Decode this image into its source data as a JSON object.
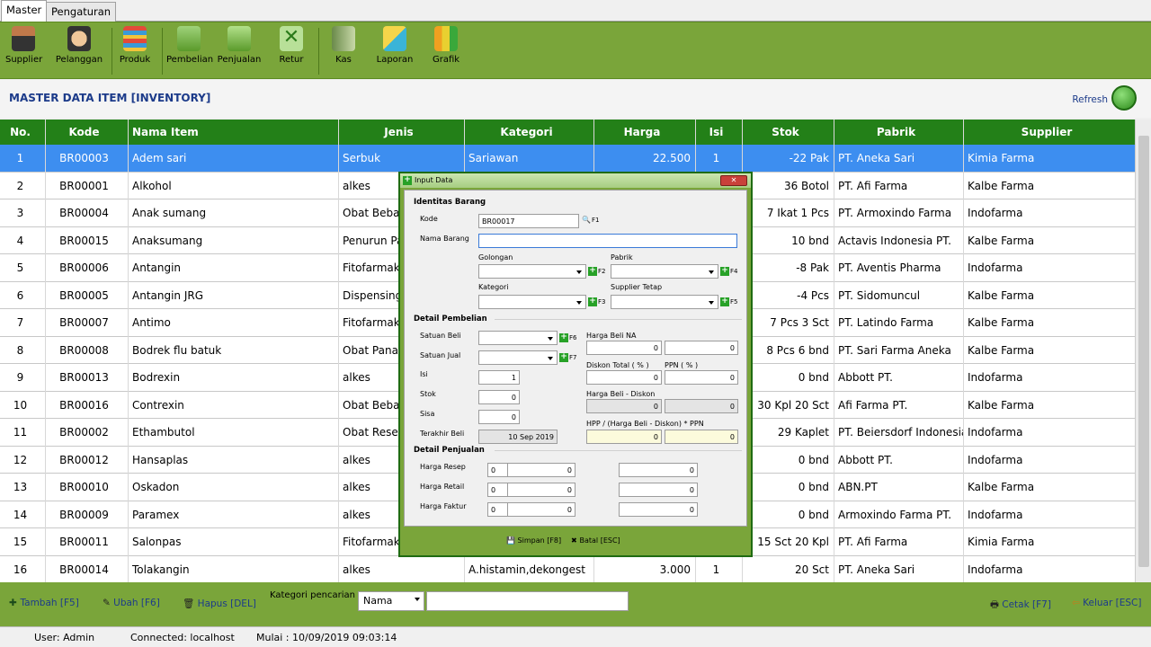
{
  "tabs": [
    "Master",
    "Pengaturan"
  ],
  "toolbar": [
    {
      "label": "Supplier",
      "icon": "supplier-icon"
    },
    {
      "label": "Pelanggan",
      "icon": "pelanggan-icon"
    },
    {
      "label": "Produk",
      "icon": "produk-icon"
    },
    {
      "label": "Pembelian",
      "icon": "pembelian-icon"
    },
    {
      "label": "Penjualan",
      "icon": "penjualan-icon"
    },
    {
      "label": "Retur",
      "icon": "retur-icon"
    },
    {
      "label": "Kas",
      "icon": "kas-icon"
    },
    {
      "label": "Laporan",
      "icon": "laporan-icon"
    },
    {
      "label": "Grafik",
      "icon": "grafik-icon"
    }
  ],
  "page_title": "MASTER DATA ITEM [INVENTORY]",
  "refresh_label": "Refresh",
  "columns": [
    "No.",
    "Kode",
    "Nama Item",
    "Jenis",
    "Kategori",
    "Harga",
    "Isi",
    "Stok",
    "Pabrik",
    "Supplier"
  ],
  "rows": [
    [
      "1",
      "BR00003",
      "Adem sari",
      "Serbuk",
      "Sariawan",
      "22.500",
      "1",
      "-22 Pak",
      "PT. Aneka Sari",
      "Kimia Farma"
    ],
    [
      "2",
      "BR00001",
      "Alkohol",
      "alkes",
      "",
      "",
      "",
      "36 Botol",
      "PT. Afi Farma",
      "Kalbe Farma"
    ],
    [
      "3",
      "BR00004",
      "Anak sumang",
      "Obat Bebas",
      "",
      "",
      "",
      "7 Ikat 1 Pcs",
      "PT. Armoxindo Farma",
      "Indofarma"
    ],
    [
      "4",
      "BR00015",
      "Anaksumang",
      "Penurun Pa",
      "",
      "",
      "",
      "10 bnd",
      "Actavis Indonesia PT.",
      "Kalbe Farma"
    ],
    [
      "5",
      "BR00006",
      "Antangin",
      "Fitofarmaka",
      "",
      "",
      "",
      "-8 Pak",
      "PT. Aventis Pharma",
      "Indofarma"
    ],
    [
      "6",
      "BR00005",
      "Antangin JRG",
      "Dispensing",
      "",
      "",
      "",
      "-4 Pcs",
      "PT. Sidomuncul",
      "Kalbe Farma"
    ],
    [
      "7",
      "BR00007",
      "Antimo",
      "Fitofarmaka",
      "",
      "",
      "",
      "7 Pcs 3 Sct",
      "PT. Latindo Farma",
      "Kalbe Farma"
    ],
    [
      "8",
      "BR00008",
      "Bodrek flu batuk",
      "Obat Panas",
      "",
      "",
      "",
      "8 Pcs 6 bnd",
      "PT. Sari Farma Aneka",
      "Kalbe Farma"
    ],
    [
      "9",
      "BR00013",
      "Bodrexin",
      "alkes",
      "",
      "",
      "",
      "0 bnd",
      "Abbott PT.",
      "Indofarma"
    ],
    [
      "10",
      "BR00016",
      "Contrexin",
      "Obat Bebas",
      "",
      "",
      "",
      "30 Kpl 20 Sct",
      "Afi Farma PT.",
      "Kalbe Farma"
    ],
    [
      "11",
      "BR00002",
      "Ethambutol",
      "Obat Resep",
      "",
      "",
      "",
      "29 Kaplet",
      "PT. Beiersdorf Indonesia",
      "Indofarma"
    ],
    [
      "12",
      "BR00012",
      "Hansaplas",
      "alkes",
      "",
      "",
      "",
      "0 bnd",
      "Abbott PT.",
      "Indofarma"
    ],
    [
      "13",
      "BR00010",
      "Oskadon",
      "alkes",
      "",
      "",
      "",
      "0 bnd",
      "ABN.PT",
      "Kalbe Farma"
    ],
    [
      "14",
      "BR00009",
      "Paramex",
      "alkes",
      "",
      "",
      "",
      "0 bnd",
      "Armoxindo Farma PT.",
      "Indofarma"
    ],
    [
      "15",
      "BR00011",
      "Salonpas",
      "Fitofarmaka",
      "",
      "",
      "",
      "15 Sct 20 Kpl",
      "PT. Afi Farma",
      "Kimia Farma"
    ],
    [
      "16",
      "BR00014",
      "Tolakangin",
      "alkes",
      "A.histamin,dekongest",
      "3.000",
      "1",
      "20 Sct",
      "PT. Aneka Sari",
      "Indofarma"
    ]
  ],
  "bottom": {
    "tambah": "Tambah [F5]",
    "ubah": "Ubah [F6]",
    "hapus": "Hapus [DEL]",
    "kategori_label": "Kategori pencarian :",
    "kategori_value": "Nama",
    "cetak": "Cetak [F7]",
    "keluar": "Keluar [ESC]"
  },
  "status": {
    "user": "User: Admin",
    "connected": "Connected: localhost",
    "mulai": "Mulai : 10/09/2019  09:03:14"
  },
  "dialog": {
    "title": "Input Data",
    "sec_identitas": "Identitas Barang",
    "kode_label": "Kode",
    "kode_value": "BR00017",
    "f1": "F1",
    "nama_label": "Nama Barang",
    "golongan_label": "Golongan",
    "f2": "F2",
    "pabrik_label": "Pabrik",
    "f4": "F4",
    "kategori_label": "Kategori",
    "f3": "F3",
    "supplier_label": "Supplier Tetap",
    "f5": "F5",
    "sec_pembelian": "Detail Pembelian",
    "satuan_beli": "Satuan Beli",
    "f6": "F6",
    "satuan_jual": "Satuan Jual",
    "f7": "F7",
    "isi_label": "Isi",
    "isi_value": "1",
    "stok_label": "Stok",
    "stok_value": "0",
    "sisa_label": "Sisa",
    "sisa_value": "0",
    "terakhir_label": "Terakhir Beli",
    "terakhir_value": "10 Sep 2019",
    "harga_beli_na": "Harga Beli NA",
    "hbna_value": "0",
    "hbna_value2": "0",
    "diskon_label": "Diskon Total ( % )",
    "ppn_label": "PPN ( % )",
    "diskon_value": "0",
    "ppn_value": "0",
    "hb_diskon_label": "Harga Beli - Diskon",
    "hbd_value": "0",
    "hbd_value2": "0",
    "hpp_label": "HPP / (Harga Beli - Diskon) * PPN",
    "hpp_value": "0",
    "hpp_value2": "0",
    "sec_penjualan": "Detail Penjualan",
    "resep_label": "Harga Resep",
    "retail_label": "Harga Retail",
    "faktur_label": "Harga Faktur",
    "zero": "0",
    "simpan": "Simpan [F8]",
    "batal": "Batal [ESC]"
  }
}
